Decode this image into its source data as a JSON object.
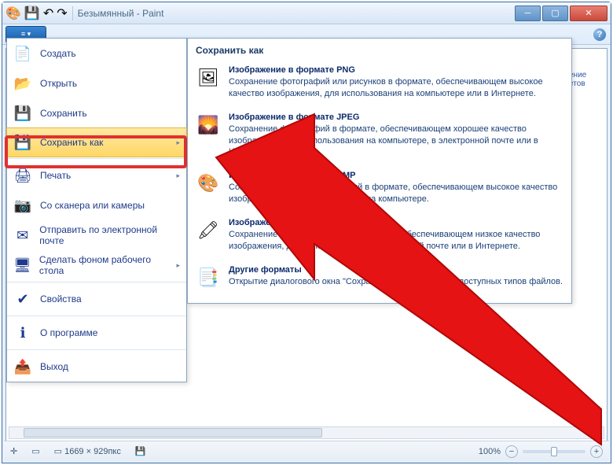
{
  "window": {
    "title": "Безымянный - Paint"
  },
  "ribbon": {
    "app_button": "≡ ▾",
    "help": "?"
  },
  "canvas_hint": "ение\nетов",
  "file_menu": {
    "items": [
      {
        "id": "new",
        "label": "Создать",
        "icon": "📄"
      },
      {
        "id": "open",
        "label": "Открыть",
        "icon": "📂"
      },
      {
        "id": "save",
        "label": "Сохранить",
        "icon": "💾"
      },
      {
        "id": "saveas",
        "label": "Сохранить как",
        "icon": "💾",
        "selected": true,
        "arrow": "▸"
      },
      {
        "id": "print",
        "label": "Печать",
        "icon": "🖨",
        "arrow": "▸"
      },
      {
        "id": "scanner",
        "label": "Со сканера или камеры",
        "icon": "📷"
      },
      {
        "id": "email",
        "label": "Отправить по электронной почте",
        "icon": "✉"
      },
      {
        "id": "wallpaper",
        "label": "Сделать фоном рабочего стола",
        "icon": "🖥",
        "arrow": "▸"
      },
      {
        "id": "properties",
        "label": "Свойства",
        "icon": "✔"
      },
      {
        "id": "about",
        "label": "О программе",
        "icon": "ℹ"
      },
      {
        "id": "exit",
        "label": "Выход",
        "icon": "📤"
      }
    ]
  },
  "submenu": {
    "title": "Сохранить как",
    "items": [
      {
        "icon": "🖼",
        "heading": "Изображение в формате PNG",
        "desc": "Сохранение фотографий или рисунков в формате, обеспечивающем высокое качество изображения, для использования на компьютере или в Интернете."
      },
      {
        "icon": "🌄",
        "heading": "Изображение в формате JPEG",
        "desc": "Сохранение фотографий в формате, обеспечивающем хорошее качество изображения, для использования на компьютере, в электронной почте или в Интернете."
      },
      {
        "icon": "🎨",
        "heading": "Изображение в формате BMP",
        "desc": "Сохранение любых изображений в формате, обеспечивающем высокое качество изображения, для использования на компьютере."
      },
      {
        "icon": "🖍",
        "heading": "Изображение в формате GIF",
        "desc": "Сохранение простых рисунков в формате, обеспечивающем низкое качество изображения, для использования в электронной почте или в Интернете."
      },
      {
        "icon": "📑",
        "heading": "Другие форматы",
        "desc": "Открытие диалогового окна \"Сохранить как\" для выбора доступных типов файлов."
      }
    ]
  },
  "status": {
    "dimensions": "1669 × 929пкс",
    "zoom": "100%"
  }
}
